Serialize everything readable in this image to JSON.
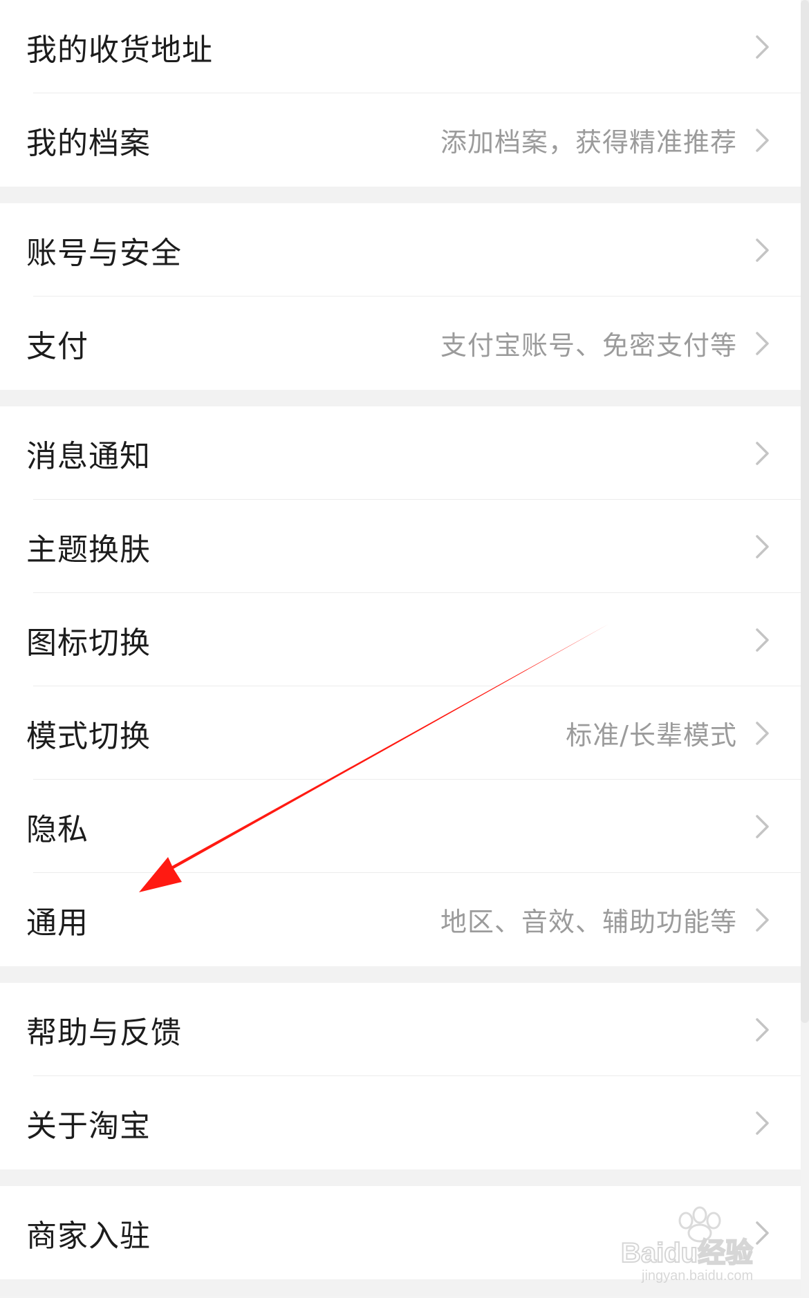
{
  "sections": [
    {
      "items": [
        {
          "id": "shipping-address",
          "label": "我的收货地址",
          "hint": ""
        },
        {
          "id": "my-profile",
          "label": "我的档案",
          "hint": "添加档案，获得精准推荐"
        }
      ]
    },
    {
      "items": [
        {
          "id": "account-security",
          "label": "账号与安全",
          "hint": ""
        },
        {
          "id": "payment",
          "label": "支付",
          "hint": "支付宝账号、免密支付等"
        }
      ]
    },
    {
      "items": [
        {
          "id": "notifications",
          "label": "消息通知",
          "hint": ""
        },
        {
          "id": "theme-skin",
          "label": "主题换肤",
          "hint": ""
        },
        {
          "id": "icon-switch",
          "label": "图标切换",
          "hint": ""
        },
        {
          "id": "mode-switch",
          "label": "模式切换",
          "hint": "标准/长辈模式"
        },
        {
          "id": "privacy",
          "label": "隐私",
          "hint": ""
        },
        {
          "id": "general",
          "label": "通用",
          "hint": "地区、音效、辅助功能等"
        }
      ]
    },
    {
      "items": [
        {
          "id": "help-feedback",
          "label": "帮助与反馈",
          "hint": ""
        },
        {
          "id": "about-taobao",
          "label": "关于淘宝",
          "hint": ""
        }
      ]
    },
    {
      "items": [
        {
          "id": "merchant-join",
          "label": "商家入驻",
          "hint": ""
        }
      ]
    }
  ],
  "icons": {
    "row_chevron": "chevron-right-icon"
  },
  "annotation": {
    "arrow_color": "#ff1a12",
    "target_item": "general"
  },
  "watermark": {
    "brand": "Baidu经验",
    "url": "jingyan.baidu.com"
  },
  "colors": {
    "background": "#f3f3f3",
    "row_background": "#ffffff",
    "label": "#1c1c1c",
    "hint": "#9b9b9b",
    "chevron": "#c4c4c4"
  }
}
